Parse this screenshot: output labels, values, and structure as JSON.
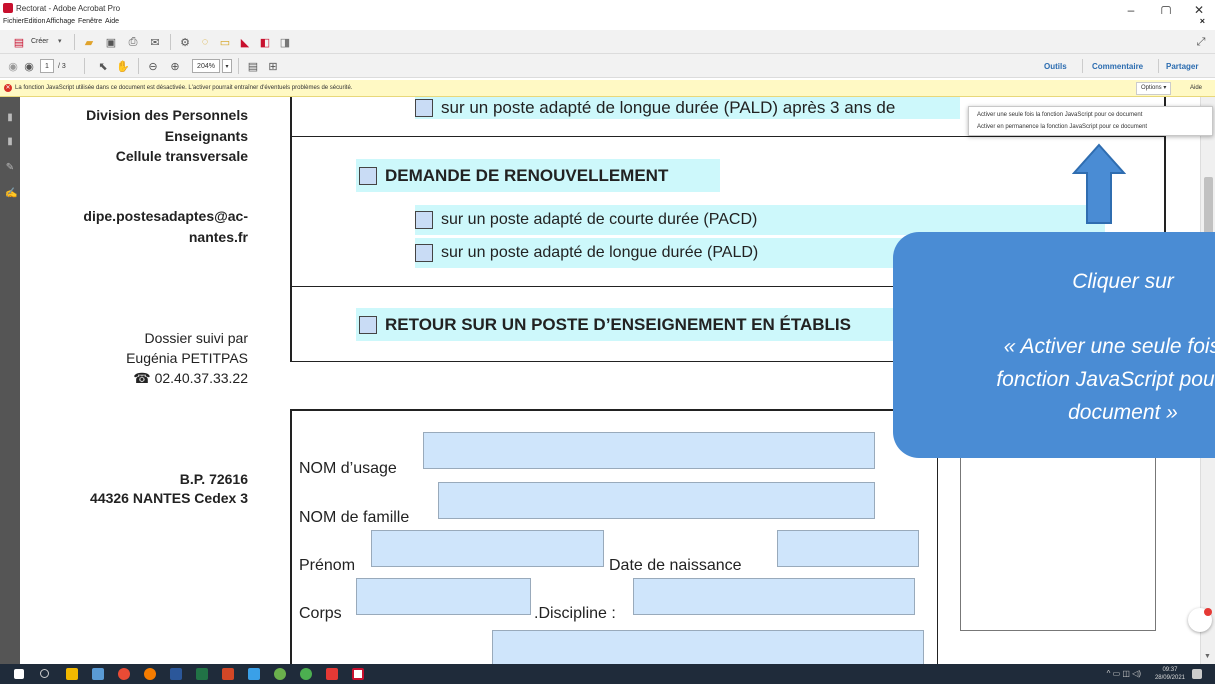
{
  "window": {
    "title": "Rectorat - Adobe Acrobat Pro",
    "minimize": "–",
    "maximize": "▢",
    "close": "✕"
  },
  "menu": {
    "items": [
      "Fichier",
      "Edition",
      "Affichage",
      "Fenêtre",
      "Aide"
    ],
    "close": "×"
  },
  "toolbar": {
    "create_label": "Créer",
    "page_current": "1",
    "page_total": "/ 3",
    "zoom": "204%",
    "tabs": [
      "Outils",
      "Commentaire",
      "Partager"
    ]
  },
  "js_bar": {
    "message": "La fonction JavaScript utilisée dans ce document est désactivée. L'activer pourrait entraîner d'éventuels problèmes de sécurité.",
    "options_label": "Options",
    "aide_label": "Aide"
  },
  "dropdown": {
    "items": [
      "Activer une seule fois la fonction JavaScript pour ce document",
      "Activer en permanence la fonction JavaScript pour ce document"
    ]
  },
  "document": {
    "left": {
      "division": "Division des Personnels",
      "enseignants": "Enseignants",
      "cellule": "Cellule transversale",
      "email1": "dipe.postesadaptes@ac-",
      "email2": "nantes.fr",
      "dossier": "Dossier suivi par",
      "person": "Eugénia PETITPAS",
      "phone": "☎ 02.40.37.33.22",
      "bp": "B.P. 72616",
      "city": "44326 NANTES Cedex 3"
    },
    "top_partial": "sur un poste adapté de longue durée (PALD) après 3 ans de",
    "renouvellement": "DEMANDE DE RENOUVELLEMENT",
    "opt_pacd": "sur un poste adapté de courte durée (PACD)",
    "opt_pald": "sur un poste adapté de longue durée (PALD)",
    "retour": "RETOUR SUR UN POSTE D’ENSEIGNEMENT EN ÉTABLIS",
    "fields": {
      "nom_usage": "NOM d’usage",
      "nom_famille": "NOM de famille",
      "prenom": "Prénom",
      "date_naissance": "Date de naissance",
      "corps": "Corps",
      "discipline": ".Discipline :"
    }
  },
  "callout": {
    "line1": "Cliquer sur",
    "line2a": "« Activer une seule fois la",
    "line2b": "fonction JavaScript pour ce",
    "line2c": "document »"
  },
  "taskbar": {
    "time": "09:37",
    "date": "28/09/2021"
  },
  "colors": {
    "callout": "#4a8cd4",
    "field": "#cfe5fb",
    "highlight": "#cdf8fb",
    "js_bar": "#fff9c4"
  }
}
